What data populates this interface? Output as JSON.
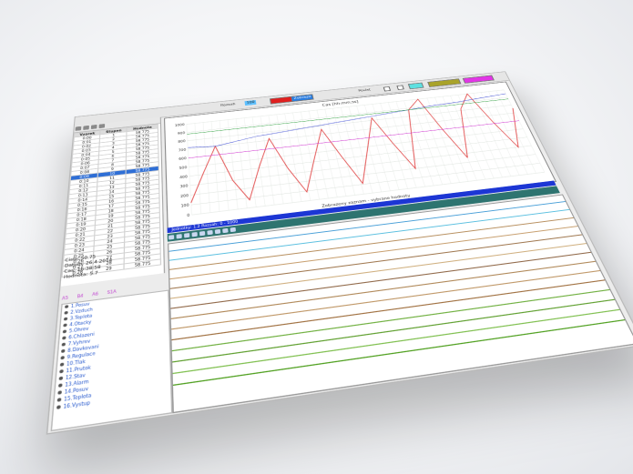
{
  "toolbar": {
    "label_a": "Rozsah",
    "label_b": "100",
    "label_c": "Poslat",
    "swatch_blue": "Zobrazit"
  },
  "left_table": {
    "headers": [
      "Vzorek",
      "Stupen",
      "Hodnota"
    ],
    "rows": [
      [
        "0:00",
        "1",
        "58.775"
      ],
      [
        "0:01",
        "2",
        "58.775"
      ],
      [
        "0:02",
        "3",
        "58.775"
      ],
      [
        "0:03",
        "4",
        "58.775"
      ],
      [
        "0:04",
        "5",
        "58.775"
      ],
      [
        "0:05",
        "6",
        "58.775"
      ],
      [
        "0:06",
        "7",
        "58.775"
      ],
      [
        "0:07",
        "8",
        "58.775"
      ],
      [
        "0:08",
        "9",
        "58.775"
      ],
      [
        "0:09",
        "10",
        "58.775"
      ],
      [
        "0:10",
        "11",
        "58.775"
      ],
      [
        "0:11",
        "12",
        "58.775"
      ],
      [
        "0:12",
        "13",
        "58.775"
      ],
      [
        "0:13",
        "14",
        "58.775"
      ],
      [
        "0:14",
        "15",
        "58.775"
      ],
      [
        "0:15",
        "16",
        "58.775"
      ],
      [
        "0:16",
        "17",
        "58.775"
      ],
      [
        "0:17",
        "18",
        "58.775"
      ],
      [
        "0:18",
        "19",
        "58.775"
      ],
      [
        "0:19",
        "20",
        "58.775"
      ],
      [
        "0:20",
        "21",
        "58.775"
      ],
      [
        "0:21",
        "22",
        "58.775"
      ],
      [
        "0:22",
        "23",
        "58.775"
      ],
      [
        "0:23",
        "24",
        "58.775"
      ],
      [
        "0:24",
        "25",
        "58.775"
      ],
      [
        "0:25",
        "26",
        "58.775"
      ],
      [
        "0:26",
        "27",
        "58.775"
      ],
      [
        "0:27",
        "28",
        "58.775"
      ],
      [
        "0:28",
        "29",
        "58.775"
      ]
    ],
    "selected_index": 9
  },
  "info": {
    "line1": "Cislo: 50.75",
    "line2": "Datum: 26.4.2014",
    "line3": "Cas: 16:38:58",
    "line4": "Hodnota: 5.7"
  },
  "tabs": [
    "A5",
    "B4",
    "A6",
    "S1A"
  ],
  "legend": [
    "1.Posuv",
    "2.Vzduch",
    "3.Teplota",
    "4.Otacky",
    "5.Ohrev",
    "6.Chlazeni",
    "7.Vyhrev",
    "8.Davkovani",
    "9.Regulace",
    "10.Tlak",
    "11.Prutok",
    "12.Stav",
    "13.Alarm",
    "14.Posuv",
    "15.Teplota",
    "16.Vystup"
  ],
  "chart": {
    "header": "Cas [hh:mm:ss]",
    "footer": "Zobrazeny zaznam - vybrane hodnoty",
    "bluebar_text": "Jednotky: 1.2   Rozsah: 0 - 1000",
    "y_ticks": [
      "1000",
      "900",
      "800",
      "700",
      "600",
      "500",
      "400",
      "300",
      "200",
      "100",
      "0"
    ]
  },
  "chart_data": {
    "type": "line",
    "title": "",
    "xlabel": "",
    "ylabel": "",
    "ylim": [
      0,
      1000
    ],
    "series": [
      {
        "values": [
          120,
          420,
          700,
          300,
          80,
          420,
          720,
          360,
          90,
          430,
          760,
          420,
          110,
          470,
          830,
          500,
          200,
          880,
          1000,
          600,
          250,
          820,
          1000,
          620,
          300,
          760
        ]
      },
      {
        "values": [
          720,
          710,
          700,
          720,
          740,
          760,
          770,
          780,
          790,
          800,
          810,
          820,
          830,
          840,
          850,
          860,
          870,
          880,
          890,
          900,
          905,
          910,
          920,
          930,
          940,
          950
        ]
      },
      {
        "values": [
          600,
          600,
          600,
          600,
          600,
          600,
          600,
          600,
          600,
          600,
          600,
          600,
          600,
          600,
          600,
          600,
          600,
          600,
          600,
          600,
          600,
          600,
          600,
          600,
          600,
          600
        ]
      },
      {
        "values": [
          880,
          880,
          880,
          880,
          880,
          880,
          880,
          880,
          880,
          880,
          880,
          880,
          880,
          880,
          880,
          880,
          880,
          880,
          880,
          880,
          880,
          880,
          880,
          880,
          880,
          880
        ]
      }
    ],
    "colors": [
      "#e04040",
      "#3040d0",
      "#d030d0",
      "#30a040"
    ]
  }
}
